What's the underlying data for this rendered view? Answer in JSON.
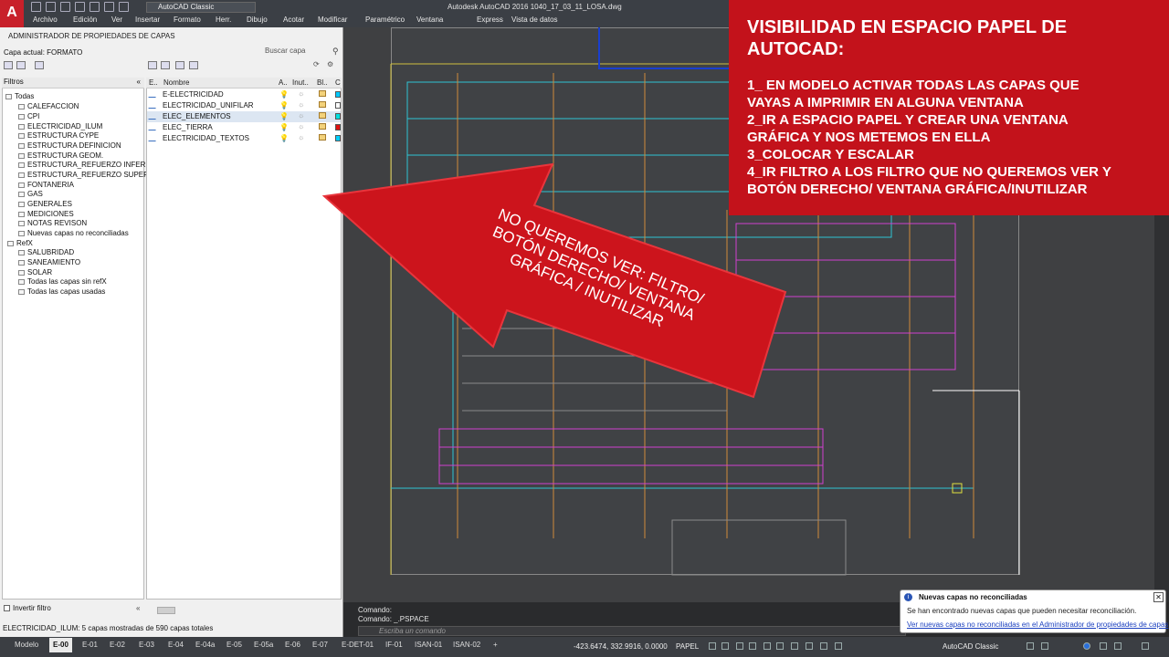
{
  "app": {
    "logo_letter": "A",
    "workspace": "AutoCAD Classic",
    "window_title": "Autodesk AutoCAD 2016    1040_17_03_11_LOSA.dwg"
  },
  "menu": [
    "Archivo",
    "Edición",
    "Ver",
    "Insertar",
    "Formato",
    "Herr.",
    "Dibujo",
    "Acotar",
    "Modificar",
    "Paramétrico",
    "Ventana",
    "Express",
    "Vista de datos"
  ],
  "layer_panel": {
    "title": "ADMINISTRADOR DE PROPIEDADES DE CAPAS",
    "current_layer": "Capa actual: FORMATO",
    "search_label": "Buscar capa",
    "filters_header": "Filtros",
    "filters": [
      "Todas",
      "CALEFACCION",
      "CPI",
      "ELECTRICIDAD_ILUM",
      "ESTRUCTURA CYPE",
      "ESTRUCTURA DEFINICION",
      "ESTRUCTURA GEOM.",
      "ESTRUCTURA_REFUERZO INFERIOR",
      "ESTRUCTURA_REFUERZO SUPERIOR",
      "FONTANERIA",
      "GAS",
      "GENERALES",
      "MEDICIONES",
      "NOTAS REVISON",
      "Nuevas capas no reconciliadas",
      "RefX",
      "SALUBRIDAD",
      "SANEAMIENTO",
      "SOLAR",
      "Todas las capas sin refX",
      "Todas las capas usadas"
    ],
    "columns": {
      "estado": "E..",
      "nombre": "Nombre",
      "activada": "A..",
      "inutilizar": "Inut..",
      "bloqueo": "Bl..",
      "color": "C"
    },
    "layers": [
      {
        "name": "E-ELECTRICIDAD",
        "color": "#00c8ff"
      },
      {
        "name": "ELECTRICIDAD_UNIFILAR",
        "color": "#ffffff"
      },
      {
        "name": "ELEC_ELEMENTOS",
        "color": "#00e0e0"
      },
      {
        "name": "ELEC_TIERRA",
        "color": "#e01010"
      },
      {
        "name": "ELECTRICIDAD_TEXTOS",
        "color": "#00d0ff"
      }
    ],
    "invert_filter": "Invertir filtro",
    "status": "ELECTRICIDAD_ILUM: 5 capas mostradas de 590 capas totales"
  },
  "banner": {
    "title": "VISIBILIDAD EN ESPACIO PAPEL DE AUTOCAD:",
    "steps": [
      "1_ EN MODELO ACTIVAR TODAS LAS CAPAS QUE",
      "VAYAS A IMPRIMIR EN ALGUNA VENTANA",
      "2_IR A ESPACIO PAPEL Y CREAR UNA VENTANA",
      "GRÁFICA Y NOS METEMOS EN ELLA",
      "3_COLOCAR Y ESCALAR",
      "4_IR FILTRO A LOS FILTRO QUE NO QUEREMOS VER Y",
      "BOTÓN DERECHO/ VENTANA GRÁFICA/INUTILIZAR"
    ],
    "color": "#c3121b"
  },
  "arrow": {
    "lines": [
      "NO QUEREMOS VER: FILTRO/",
      "BOTÓN DERECHO/ VENTANA",
      "GRÁFICA / INUTILIZAR"
    ]
  },
  "command": {
    "line1": "Comando:",
    "line2": "Comando:  _.PSPACE",
    "placeholder": "Escriba un comando"
  },
  "notification": {
    "title": "Nuevas capas no reconciliadas",
    "body": "Se han encontrado nuevas capas que pueden necesitar reconciliación.",
    "link": "Ver nuevas capas no reconciliadas en el Administrador de propiedades de capas"
  },
  "status": {
    "tabs": [
      "Modelo",
      "E-00",
      "E-01",
      "E-02",
      "E-03",
      "E-04",
      "E-04a",
      "E-05",
      "E-05a",
      "E-06",
      "E-07",
      "E-DET-01",
      "IF-01",
      "ISAN-01",
      "ISAN-02"
    ],
    "active_tab": "E-00",
    "coords": "-423.6474, 332.9916, 0.0000",
    "space": "PAPEL",
    "workspace": "AutoCAD Classic"
  }
}
